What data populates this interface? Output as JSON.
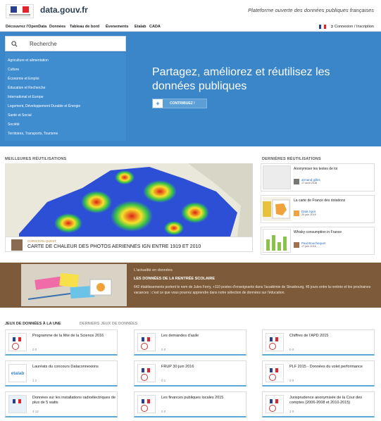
{
  "header": {
    "brand": "data.gouv.fr",
    "tagline": "Plateforme ouverte des données publiques françaises",
    "login": "Connexion / Inscription"
  },
  "nav": {
    "items": [
      "Découvrez l'OpenData",
      "Données",
      "Tableau de bord",
      "Évenements",
      "Etalab",
      "CADA"
    ]
  },
  "colors": {
    "primary": "#3a86c8",
    "band": "#7d5a3a",
    "accent_line": "#5da9d6"
  },
  "search": {
    "placeholder": "Recherche"
  },
  "categories": [
    "Agriculture et alimentation",
    "Culture",
    "Économie et Emploi",
    "Éducation et Recherche",
    "International et Europe",
    "Logement, Développement Durable et Énergie",
    "Santé et Social",
    "Société",
    "Territoires, Transports, Tourisme"
  ],
  "hero": {
    "title": "Partagez, améliorez et réutilisez les données publiques",
    "cta": "CONTRIBUEZ !"
  },
  "best_reuses": {
    "title": "MEILLEURES RÉUTILISATIONS",
    "author": "CHRISTIAN QUEST",
    "caption": "CARTE DE CHALEUR DES PHOTOS AERIENNES IGN ENTRE 1919 ET 2010"
  },
  "latest_reuses": {
    "title": "DERNIÈRES RÉUTILISATIONS",
    "items": [
      {
        "title": "Anonymiser les textes de loi",
        "author": "armand gilles",
        "date": "17 août 2016"
      },
      {
        "title": "La carte de France des dotations",
        "author": "Data Spot",
        "date": "20 juin 2016"
      },
      {
        "title": "Whisky consumption in France",
        "author": "Paul Bouchequet",
        "date": "17 juin 2016"
      }
    ]
  },
  "news": {
    "kicker": "L'actualité en données",
    "title": "LES DONNÉES DE LA RENTRÉE SCOLAIRE",
    "text": "642 établissements portent le nom de Jules Ferry, +110 postes d'enseignants dans l'académie de Strasbourg, 45 jours entre la rentrée et les prochaines vacances : c'est ce que vous pourrez apprendre dans notre sélection de données sur l'éducation."
  },
  "datasets": {
    "tab_active": "JEUX DE DONNÉES À LA UNE",
    "tab_other": "DERNIERS JEUX DE DONNÉES",
    "cards": [
      {
        "title": "Programme de la fête de la Science 2016",
        "meta": "0   0",
        "logo": "rf"
      },
      {
        "title": "Les demandes d'asile",
        "meta": "0   0",
        "logo": "rf"
      },
      {
        "title": "Chiffres de l'APD 2015",
        "meta": "0   0",
        "logo": "rf"
      },
      {
        "title": "Lauréats du concours Dataconnexions",
        "meta": "1   2",
        "logo": "etalab"
      },
      {
        "title": "FRUP 30 juin 2016",
        "meta": "0   1",
        "logo": "rf"
      },
      {
        "title": "PLF 2015 - Données du volet performance",
        "meta": "0   0",
        "logo": "rf"
      },
      {
        "title": "Données sur les installations radioélectriques de plus de 5 watts",
        "meta": "4   12",
        "logo": "ign"
      },
      {
        "title": "Les finances publiques locales 2015",
        "meta": "0   0",
        "logo": "rf"
      },
      {
        "title": "Jurisprudence anonymisée de la Cour des comptes (2006-2008 et 2010-2015)",
        "meta": "2   0",
        "logo": "rf"
      }
    ]
  }
}
